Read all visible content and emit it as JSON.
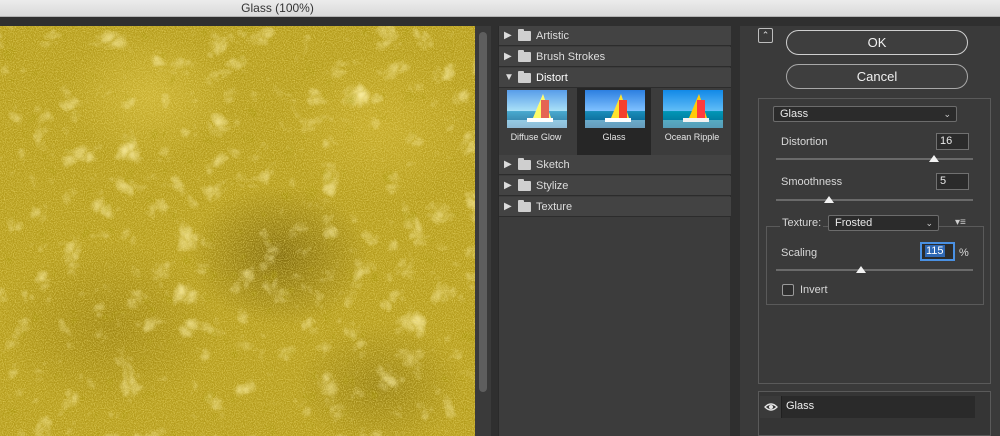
{
  "window": {
    "title": "Glass (100%)"
  },
  "gallery": {
    "folders": [
      {
        "label": "Artistic",
        "open": false
      },
      {
        "label": "Brush Strokes",
        "open": false
      },
      {
        "label": "Distort",
        "open": true
      },
      {
        "label": "Sketch",
        "open": false
      },
      {
        "label": "Stylize",
        "open": false
      },
      {
        "label": "Texture",
        "open": false
      }
    ],
    "distort_filters": [
      {
        "label": "Diffuse Glow",
        "selected": false
      },
      {
        "label": "Glass",
        "selected": true
      },
      {
        "label": "Ocean Ripple",
        "selected": false
      }
    ]
  },
  "buttons": {
    "ok": "OK",
    "cancel": "Cancel",
    "collapse_icon": "collapse-arrow-icon"
  },
  "filter": {
    "selected": "Glass",
    "distortion": {
      "label": "Distortion",
      "value": "16",
      "fraction": 0.8
    },
    "smoothness": {
      "label": "Smoothness",
      "value": "5",
      "fraction": 0.27
    },
    "texture": {
      "label": "Texture:",
      "value": "Frosted"
    },
    "scaling": {
      "label": "Scaling",
      "value": "115",
      "unit": "%",
      "fraction": 0.43
    },
    "invert": {
      "label": "Invert",
      "checked": false
    }
  },
  "layers": [
    {
      "name": "Glass",
      "visible": true,
      "icon": "eye-icon"
    }
  ],
  "colors": {
    "preview_base": "#b59c1c",
    "panel": "#3a3a3a",
    "selection": "#2f68b4"
  }
}
